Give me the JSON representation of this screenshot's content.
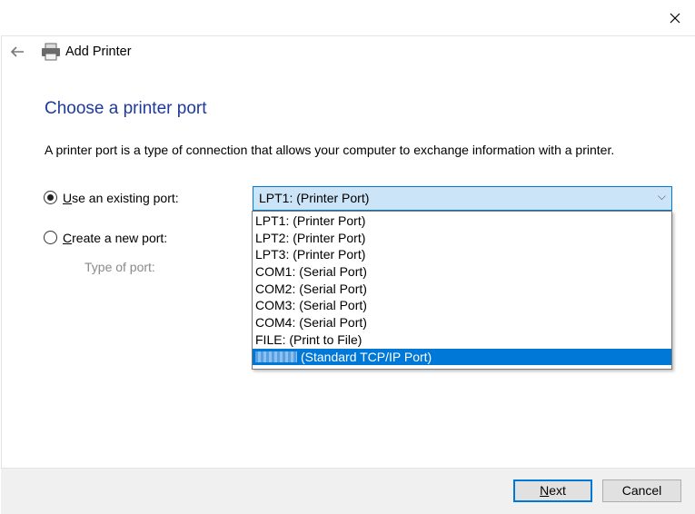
{
  "window": {
    "title": "Add Printer"
  },
  "heading": "Choose a printer port",
  "description": "A printer port is a type of connection that allows your computer to exchange information with a printer.",
  "options": {
    "existing": {
      "label": "Use an existing port:",
      "selected": true
    },
    "create": {
      "label": "Create a new port:",
      "selected": false
    },
    "type_label": "Type of port:"
  },
  "combo": {
    "value": "LPT1: (Printer Port)"
  },
  "ports": [
    "LPT1: (Printer Port)",
    "LPT2: (Printer Port)",
    "LPT3: (Printer Port)",
    "COM1: (Serial Port)",
    "COM2: (Serial Port)",
    "COM3: (Serial Port)",
    "COM4: (Serial Port)",
    "FILE: (Print to File)",
    "(Standard TCP/IP Port)"
  ],
  "buttons": {
    "next": "Next",
    "cancel": "Cancel"
  },
  "colors": {
    "accent": "#0078d7",
    "heading": "#1e3a9c"
  }
}
